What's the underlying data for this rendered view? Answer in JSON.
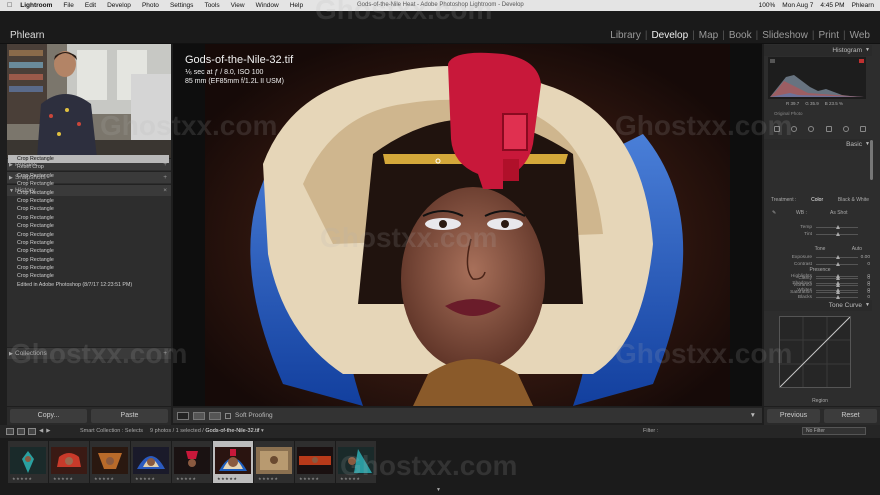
{
  "menubar": {
    "apple": "",
    "items": [
      "Lightroom",
      "File",
      "Edit",
      "Develop",
      "Photo",
      "Settings",
      "Tools",
      "View",
      "Window",
      "Help"
    ],
    "window_title": "Gods-of-the-Nile Heat - Adobe Photoshop Lightroom - Develop",
    "right": [
      "100%",
      "Mon Aug 7",
      "4:45 PM",
      "Phlearn"
    ]
  },
  "identity_plate": "Phlearn",
  "modules": [
    "Library",
    "Develop",
    "Map",
    "Book",
    "Slideshow",
    "Print",
    "Web"
  ],
  "active_module": "Develop",
  "left_panel": {
    "presets": "Presets",
    "snapshots": "Snapshots",
    "history": "History",
    "collections": "Collections",
    "history_items": [
      "Crop Rectangle",
      "Reset Crop",
      "Crop Rectangle",
      "Crop Rectangle",
      "Crop Rectangle",
      "Crop Rectangle",
      "Crop Rectangle",
      "Crop Rectangle",
      "Crop Rectangle",
      "Crop Rectangle",
      "Crop Rectangle",
      "Crop Rectangle",
      "Crop Rectangle",
      "Crop Rectangle",
      "Crop Rectangle",
      "Edited in Adobe Photoshop (8/7/17 12:23:51 PM)"
    ],
    "copy_label": "Copy...",
    "paste_label": "Paste"
  },
  "photo": {
    "filename": "Gods-of-the-Nile-32.tif",
    "exposure": "⅙ sec at ƒ / 8.0, ISO 100",
    "lens": "85 mm (EF85mm f/1.2L II USM)"
  },
  "toolbar": {
    "soft_proofing": "Soft Proofing"
  },
  "right_panel": {
    "histogram": "Histogram",
    "hist_values": [
      "R 39.7",
      "G 35.9",
      "B 23.5 %"
    ],
    "original_photo": "Original Photo",
    "basic": "Basic",
    "treatment_label": "Treatment :",
    "treatment_color": "Color",
    "treatment_bw": "Black & White",
    "wb_label": "WB :",
    "wb_value": "As Shot",
    "tone": "Tone",
    "auto": "Auto",
    "presence": "Presence",
    "sliders_wb": [
      "Temp",
      "Tint"
    ],
    "sliders_tone": [
      {
        "label": "Exposure",
        "value": "0.00"
      },
      {
        "label": "Contrast",
        "value": "0"
      },
      {
        "label": "Highlights",
        "value": "0"
      },
      {
        "label": "Shadows",
        "value": "0"
      },
      {
        "label": "Whites",
        "value": "0"
      },
      {
        "label": "Blacks",
        "value": "0"
      }
    ],
    "sliders_presence": [
      {
        "label": "Clarity",
        "value": "0"
      },
      {
        "label": "Vibrance",
        "value": "0"
      },
      {
        "label": "Saturation",
        "value": "0"
      }
    ],
    "tone_curve": "Tone Curve",
    "region": "Region",
    "previous_label": "Previous",
    "reset_label": "Reset"
  },
  "filmstrip_bar": {
    "pages": [
      "1",
      "2"
    ],
    "breadcrumb": "Smart Collection : Selects",
    "count_prefix": "9 photos / 1 selected /",
    "selected_file": "Gods-of-the-Nile-32.tif",
    "filter_label": "Filter :",
    "no_filter": "No Filter"
  },
  "thumbnails": [
    {
      "selected": false,
      "stars": "★★★★★"
    },
    {
      "selected": false,
      "stars": "★★★★★"
    },
    {
      "selected": false,
      "stars": "★★★★★"
    },
    {
      "selected": false,
      "stars": "★★★★★"
    },
    {
      "selected": false,
      "stars": "★★★★★"
    },
    {
      "selected": true,
      "stars": "★★★★★"
    },
    {
      "selected": false,
      "stars": "★★★★★"
    },
    {
      "selected": false,
      "stars": "★★★★★"
    },
    {
      "selected": false,
      "stars": "★★★★★"
    }
  ],
  "watermark": "Ghostxx.com",
  "colors": {
    "panel": "#2d2d2d",
    "selected_row": "#b9b9b9",
    "feather_blue": "#1e5fc0",
    "headdress_red": "#c8183a",
    "gold": "#d4a83a"
  }
}
